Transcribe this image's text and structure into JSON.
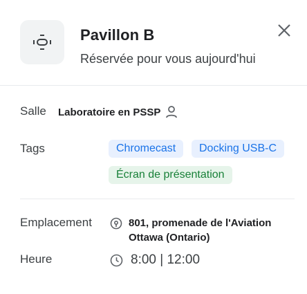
{
  "header": {
    "title": "Pavillon B",
    "subtitle": "Réservée pour vous aujourd'hui"
  },
  "icons": {
    "room": "conference-room-icon",
    "close": "close-icon",
    "person": "person-icon",
    "location": "location-pin-icon",
    "clock": "clock-icon"
  },
  "room": {
    "label": "Salle",
    "value": "Laboratoire en PSSP"
  },
  "tags": {
    "label": "Tags",
    "items": [
      "Chromecast",
      "Docking USB-C",
      "Écran de présentation"
    ]
  },
  "location": {
    "label": "Emplacement",
    "line1": "801, promenade de l'Aviation",
    "line2": "Ottawa (Ontario)"
  },
  "time": {
    "label": "Heure",
    "value": "8:00 | 12:00"
  },
  "colors": {
    "chip_blue_bg": "#e8f0fe",
    "chip_blue_text": "#1a73e8",
    "chip_green_bg": "#e6f4ea",
    "chip_green_text": "#188038"
  }
}
